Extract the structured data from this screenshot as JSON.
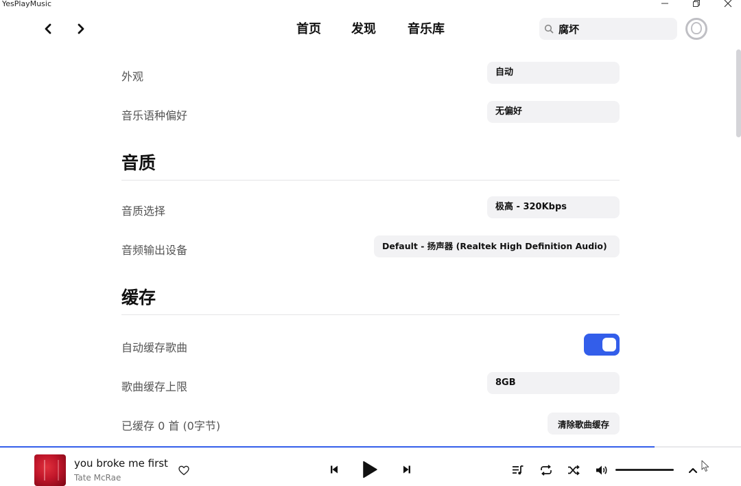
{
  "window": {
    "title": "YesPlayMusic"
  },
  "nav": {
    "tabs": [
      "首页",
      "发现",
      "音乐库"
    ],
    "search_value": "腐坏"
  },
  "settings": {
    "appearance": {
      "label": "外观",
      "value": "自动"
    },
    "language_pref": {
      "label": "音乐语种偏好",
      "value": "无偏好"
    },
    "section_quality": "音质",
    "quality_select": {
      "label": "音质选择",
      "value": "极高 - 320Kbps"
    },
    "output_device": {
      "label": "音频输出设备",
      "value": "Default - 扬声器 (Realtek High Definition Audio)"
    },
    "section_cache": "缓存",
    "auto_cache": {
      "label": "自动缓存歌曲",
      "enabled": true
    },
    "cache_limit": {
      "label": "歌曲缓存上限",
      "value": "8GB"
    },
    "cached": {
      "label": "已缓存 0 首 (0字节)",
      "button": "清除歌曲缓存"
    }
  },
  "player": {
    "song_title": "you broke me first",
    "artist": "Tate McRae",
    "progress": 0.883,
    "volume": 1.0
  },
  "colors": {
    "accent": "#335eea",
    "field_bg": "#f2f2f4"
  },
  "icons": {
    "heart": "heart-outline",
    "prev": "skip-previous",
    "play": "play",
    "next": "skip-next",
    "playlist": "queue-music",
    "repeat": "repeat",
    "shuffle": "shuffle",
    "volume": "volume-up",
    "lyrics": "chevron-up"
  }
}
